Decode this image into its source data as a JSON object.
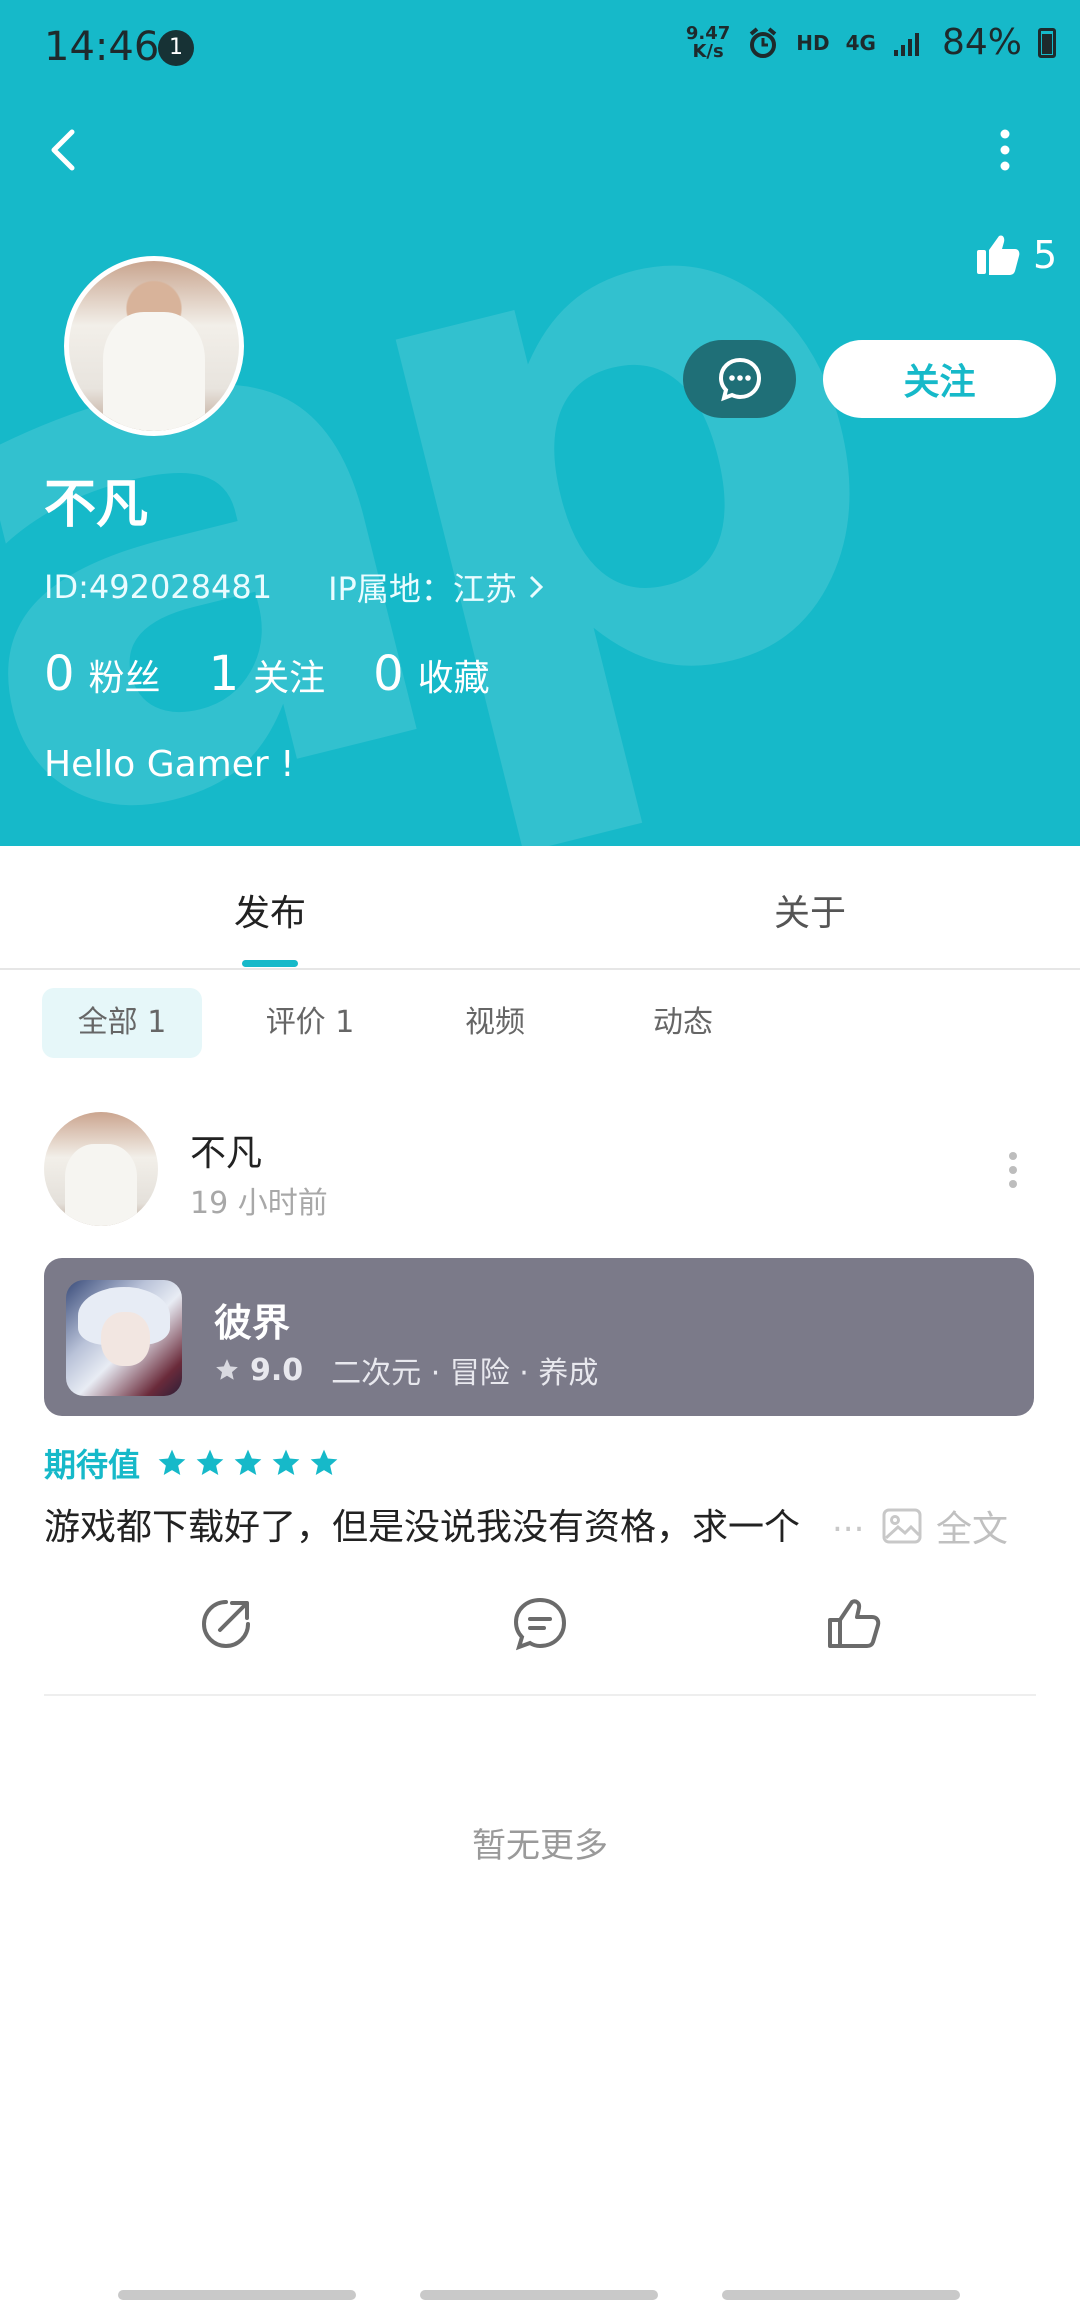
{
  "status_bar": {
    "time": "14:46",
    "notif_count": "1",
    "net_speed_value": "9.47",
    "net_speed_unit": "K/s",
    "hd": "HD",
    "network": "4G",
    "battery": "84%"
  },
  "profile": {
    "likes": "5",
    "name": "不凡",
    "follow_label": "关注",
    "id": "ID:492028481",
    "ip": "IP属地：江苏",
    "stats": [
      {
        "num": "0",
        "label": "粉丝"
      },
      {
        "num": "1",
        "label": "关注"
      },
      {
        "num": "0",
        "label": "收藏"
      }
    ],
    "bio": "Hello Gamer !"
  },
  "tabs": [
    {
      "label": "发布"
    },
    {
      "label": "关于"
    }
  ],
  "filters": [
    {
      "label": "全部 1"
    },
    {
      "label": "评价 1"
    },
    {
      "label": "视频"
    },
    {
      "label": "动态"
    }
  ],
  "post": {
    "author": "不凡",
    "time": "19 小时前",
    "game": {
      "name": "彼界",
      "score": "9.0",
      "tags": "二次元 · 冒险 · 养成"
    },
    "expect_label": "期待值",
    "stars": 5,
    "review": "游戏都下载好了，但是没说我没有资格，求一个",
    "ellipsis": "...",
    "full_text": "全文"
  },
  "footer": {
    "no_more": "暂无更多"
  },
  "colors": {
    "accent": "#16B9C9",
    "card": "#7b7a89"
  }
}
